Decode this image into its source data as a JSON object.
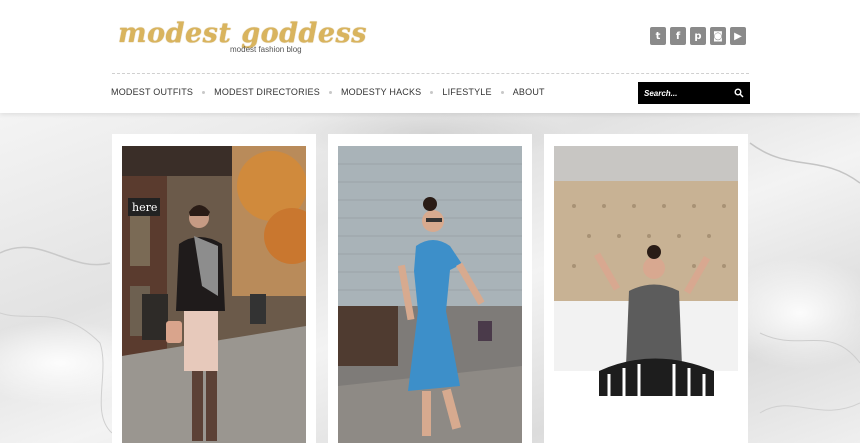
{
  "site": {
    "logo_text": "modest goddess",
    "tagline": "modest fashion blog"
  },
  "social": [
    {
      "icon": "twitter-icon",
      "glyph": "t"
    },
    {
      "icon": "facebook-icon",
      "glyph": "f"
    },
    {
      "icon": "pinterest-icon",
      "glyph": "p"
    },
    {
      "icon": "instagram-icon",
      "glyph": "◙"
    },
    {
      "icon": "youtube-icon",
      "glyph": "▶"
    }
  ],
  "nav": {
    "items": [
      "MODEST OUTFITS",
      "MODEST DIRECTORIES",
      "MODESTY HACKS",
      "LIFESTYLE",
      "ABOUT"
    ]
  },
  "search": {
    "placeholder": "Search..."
  },
  "posts": [
    {
      "image": "street-outfit-photo",
      "sign_text": "here"
    },
    {
      "image": "blue-dress-photo"
    },
    {
      "image": "bedroom-lounge-photo"
    }
  ],
  "colors": {
    "logo_gold": "#d9b45e",
    "search_bg": "#000000",
    "social_bg": "#8a8a8a"
  }
}
